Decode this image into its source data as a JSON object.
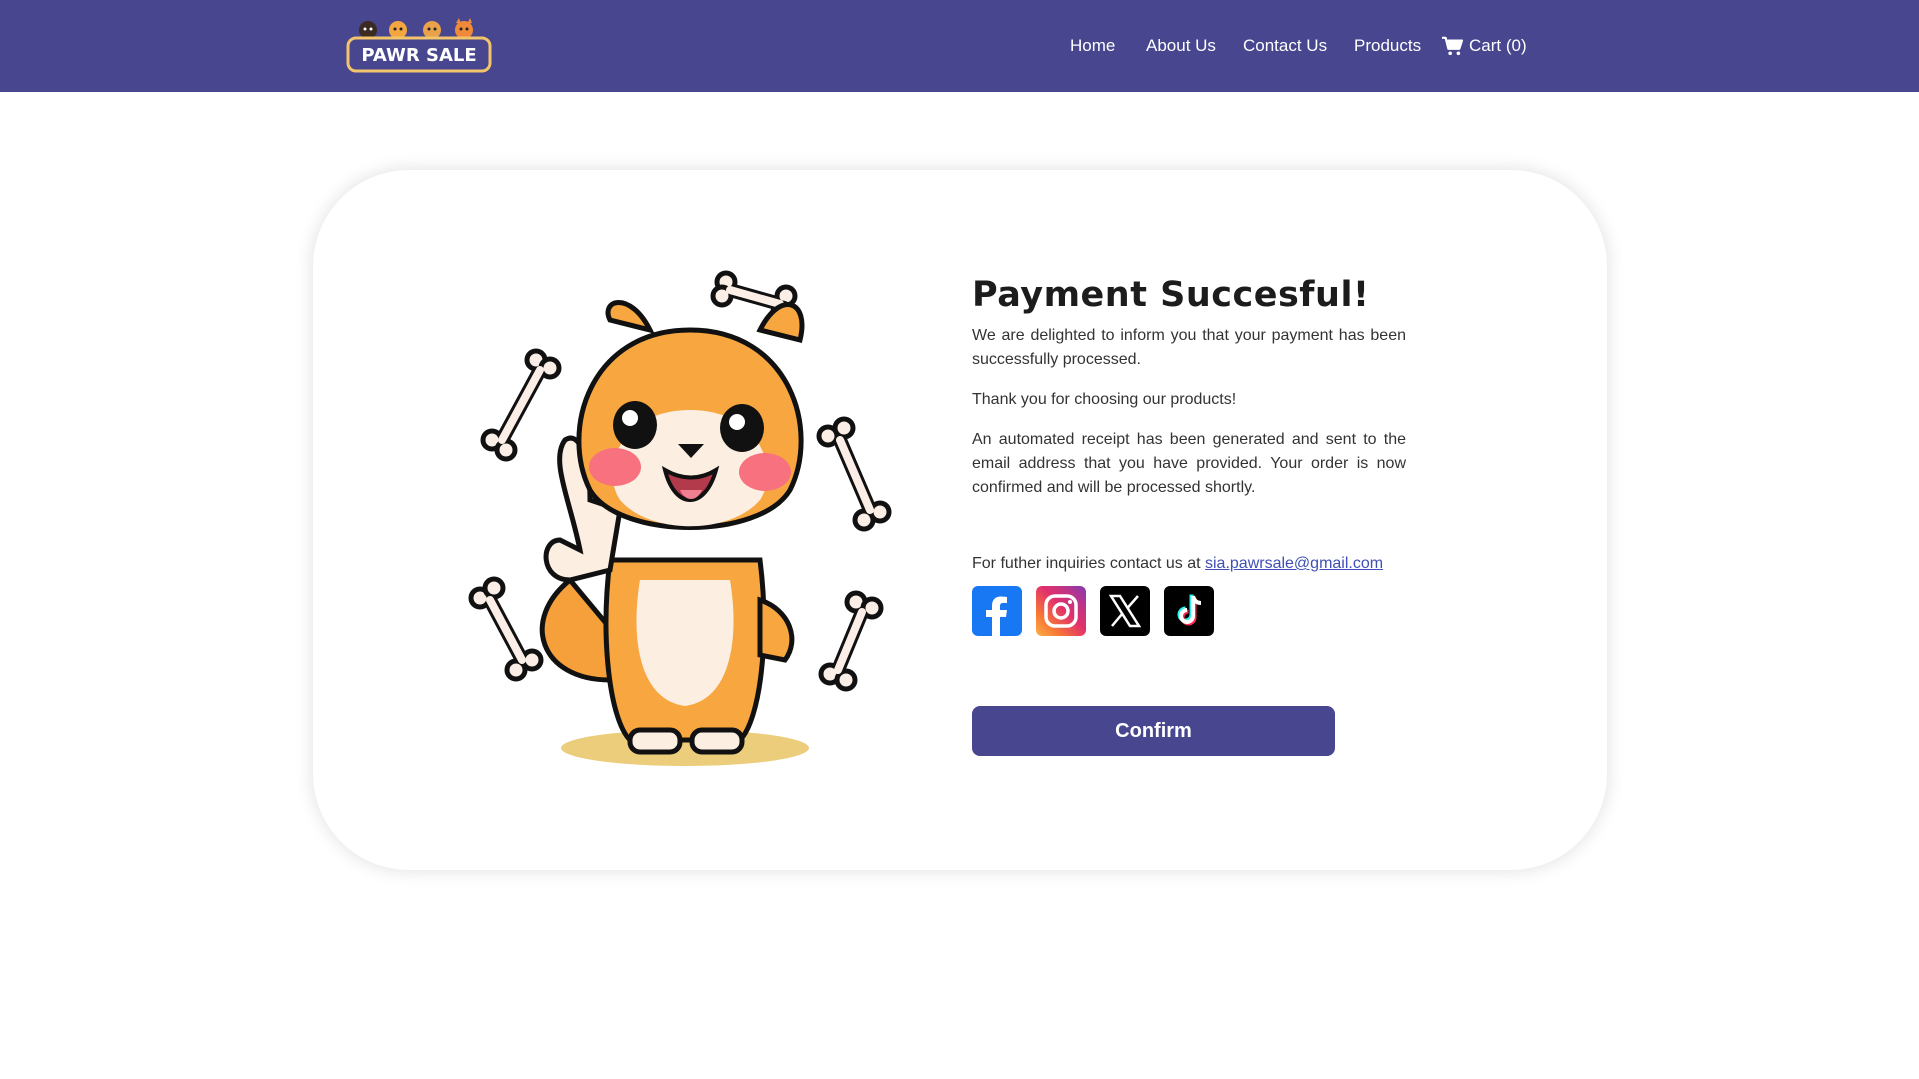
{
  "header": {
    "logo_text": "PAWR SALE",
    "nav": {
      "home": "Home",
      "about": "About Us",
      "contact": "Contact Us",
      "products": "Products",
      "cart": "Cart (0)"
    }
  },
  "payment": {
    "title": "Payment Succesful!",
    "para1": "We are delighted to inform you that your payment has been successfully processed.",
    "para2": "Thank you for choosing our products!",
    "para3": "An automated receipt has been generated and sent to the email address that you have provided. Your order is now confirmed and will be processed shortly.",
    "inquiry_text": "For futher inquiries contact us at ",
    "email": "sia.pawrsale@gmail.com",
    "confirm_label": "Confirm"
  },
  "social": [
    "facebook-icon",
    "instagram-icon",
    "x-icon",
    "tiktok-icon"
  ],
  "colors": {
    "brand": "#47468f",
    "link": "#3f4fb5"
  }
}
